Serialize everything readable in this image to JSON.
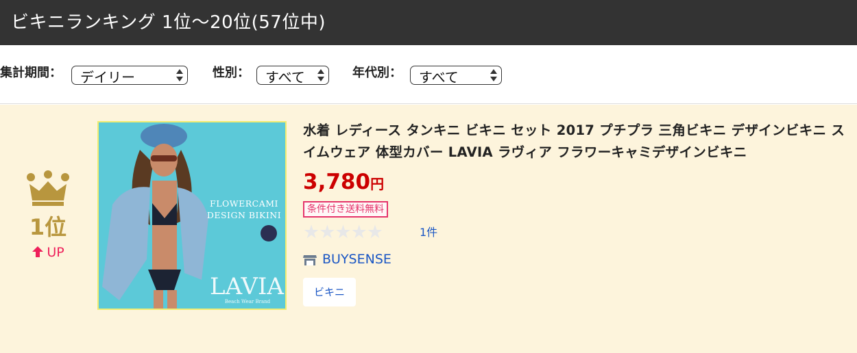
{
  "header": {
    "title": "ビキニランキング 1位〜20位(57位中)"
  },
  "filters": {
    "period": {
      "label": "集計期間：",
      "value": "デイリー"
    },
    "gender": {
      "label": "性別：",
      "value": "すべて"
    },
    "age": {
      "label": "年代別：",
      "value": "すべて"
    }
  },
  "item": {
    "rank": "1位",
    "rank_change": "UP",
    "image": {
      "overlay_line1": "FLOWERCAMI",
      "overlay_line2": "DESIGN BIKINI",
      "brand": "LAVIA.",
      "brand_sub": "Beach Wear Brand"
    },
    "title": "水着 レディース タンキニ ビキニ セット 2017 プチプラ 三角ビキニ デザインビキニ スイムウェア 体型カバー LAVIA ラヴィア フラワーキャミデザインビキニ",
    "price": "3,780",
    "price_unit": "円",
    "shipping": "条件付き送料無料",
    "rating_stars": "★★★★★",
    "rating_value": 0,
    "review_count": "1件",
    "shop": "BUYSENSE",
    "tag": "ビキニ"
  },
  "colors": {
    "header_bg": "#333333",
    "item_bg": "#fdf4dc",
    "rank_gold": "#b8963e",
    "up_pink": "#ee1f5a",
    "price_red": "#cc0000",
    "link_blue": "#1a56c4",
    "shipping_pink": "#e5336b"
  },
  "icons": {
    "rank": "crown-icon",
    "rank_change": "up-arrow-icon",
    "shop": "shop-icon"
  }
}
